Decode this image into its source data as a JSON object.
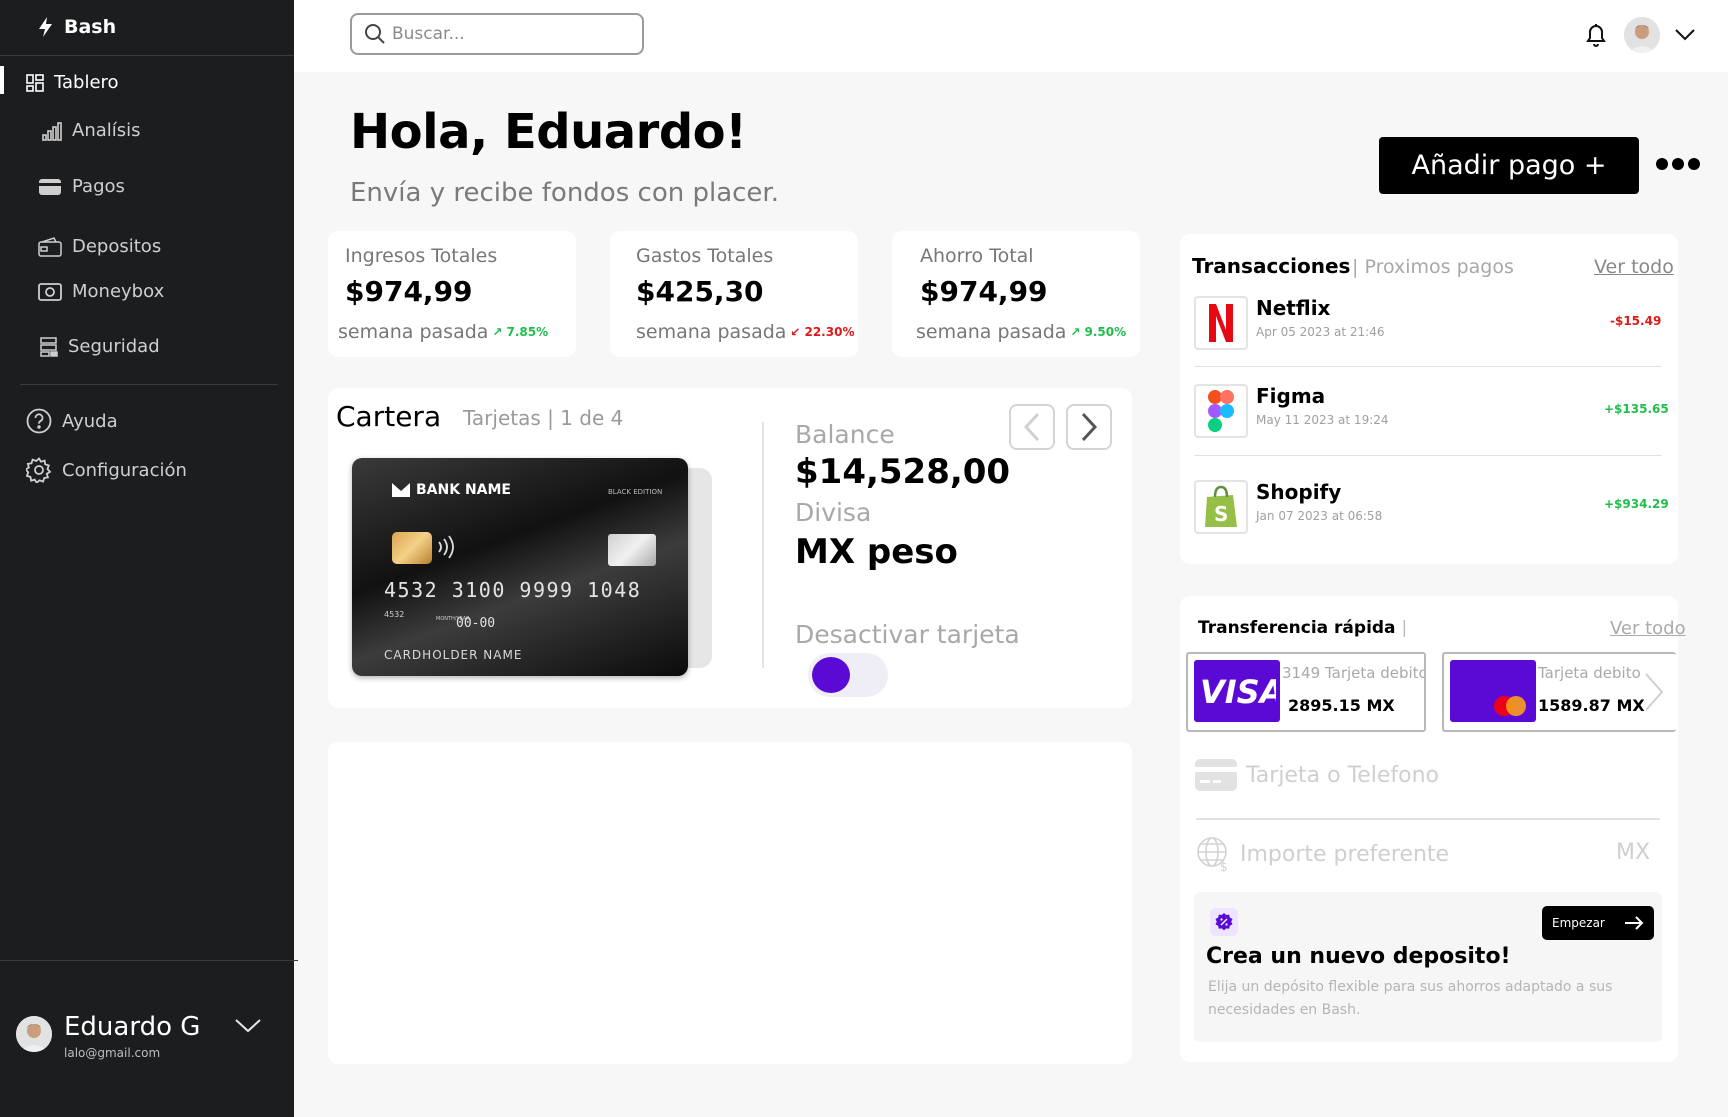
{
  "app": {
    "name": "Bash"
  },
  "sidebar": {
    "items": [
      {
        "label": "Tablero",
        "icon": "dashboard-icon"
      },
      {
        "label": "Analísis",
        "icon": "bar-chart-icon"
      },
      {
        "label": "Pagos",
        "icon": "credit-card-icon"
      },
      {
        "label": "Depositos",
        "icon": "wallet-icon"
      },
      {
        "label": "Moneybox",
        "icon": "money-icon"
      },
      {
        "label": "Seguridad",
        "icon": "server-lock-icon"
      },
      {
        "label": "Ayuda",
        "icon": "help-icon"
      },
      {
        "label": "Configuración",
        "icon": "gear-icon"
      }
    ],
    "profile": {
      "name": "Eduardo G",
      "email": "lalo@gmail.com"
    }
  },
  "search": {
    "placeholder": "Buscar..."
  },
  "greeting": {
    "title": "Hola, Eduardo!",
    "subtitle": "Envía y recibe fondos con placer.",
    "add_payment": "Añadir pago +"
  },
  "stats": [
    {
      "label": "Ingresos Totales",
      "value": "$974,99",
      "period": "semana pasada",
      "change": "7.85%",
      "direction": "up"
    },
    {
      "label": "Gastos Totales",
      "value": "$425,30",
      "period": "semana pasada",
      "change": "22.30%",
      "direction": "down"
    },
    {
      "label": "Ahorro Total",
      "value": "$974,99",
      "period": "semana pasada",
      "change": "9.50%",
      "direction": "up"
    }
  ],
  "wallet": {
    "title": "Cartera",
    "subtitle": "Tarjetas | 1 de 4",
    "card": {
      "bank": "BANK NAME",
      "edition": "BLACK EDITION",
      "number": "4532  3100  9999  1048",
      "short": "4532",
      "valid_label": "MONTH/YEAR",
      "expiry": "00-00",
      "holder": "CARDHOLDER NAME"
    },
    "balance_label": "Balance",
    "balance": "$14,528,00",
    "currency_label": "Divisa",
    "currency": "MX peso",
    "deactivate_label": "Desactivar tarjeta",
    "deactivate_on": true
  },
  "transactions": {
    "title": "Transacciones",
    "subtitle": "| Proximos pagos",
    "view_all": "Ver todo",
    "items": [
      {
        "name": "Netflix",
        "date": "Apr 05 2023 at 21:46",
        "amount": "-$15.49",
        "color": "#e01818"
      },
      {
        "name": "Figma",
        "date": "May 11 2023 at 19:24",
        "amount": "+$135.65",
        "color": "#1fbf4a"
      },
      {
        "name": "Shopify",
        "date": "Jan 07 2023 at 06:58",
        "amount": "+$934.29",
        "color": "#1fbf4a"
      }
    ]
  },
  "quick_transfer": {
    "title": "Transferencia rápida",
    "view_all": "Ver todo",
    "cards": [
      {
        "brand": "VISA",
        "desc": "3149 Tarjeta debito",
        "amount": "2895.15 MX"
      },
      {
        "brand": "Mastercard",
        "desc": "Tarjeta debito",
        "amount": "1589.87 MX"
      }
    ],
    "card_field_placeholder": "Tarjeta o Telefono",
    "amount_field_placeholder": "Importe preferente",
    "amount_unit": "MX"
  },
  "promo": {
    "button": "Empezar",
    "title": "Crea un nuevo deposito!",
    "text": "Elija un depósito flexible para sus ahorros adaptado a sus necesidades en Bash."
  }
}
